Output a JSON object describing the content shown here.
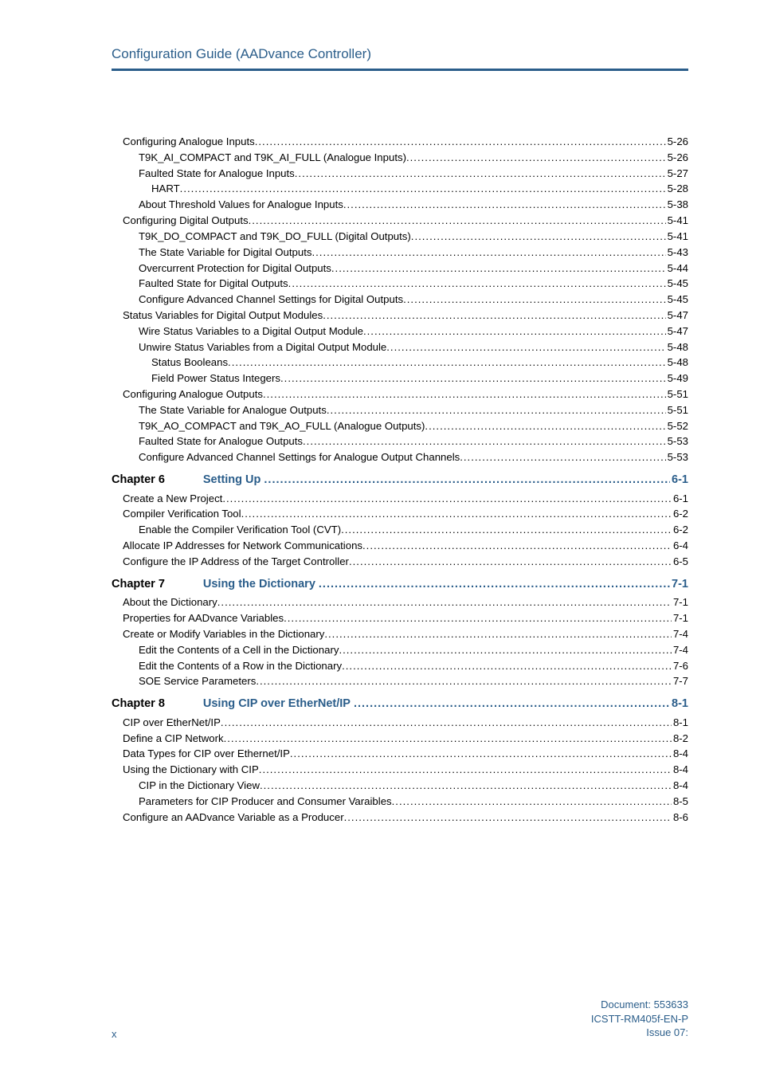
{
  "header": {
    "title": "Configuration Guide (AADvance Controller)"
  },
  "toc": [
    {
      "kind": "item",
      "level": 1,
      "label": "Configuring Analogue Inputs",
      "page": "5-26"
    },
    {
      "kind": "item",
      "level": 2,
      "label": "T9K_AI_COMPACT and T9K_AI_FULL (Analogue Inputs)",
      "page": "5-26"
    },
    {
      "kind": "item",
      "level": 2,
      "label": "Faulted State for Analogue Inputs",
      "page": "5-27"
    },
    {
      "kind": "item",
      "level": 3,
      "label": "HART",
      "page": "5-28"
    },
    {
      "kind": "item",
      "level": 2,
      "label": "About Threshold Values for Analogue Inputs",
      "page": "5-38"
    },
    {
      "kind": "item",
      "level": 1,
      "label": "Configuring Digital Outputs",
      "page": "5-41"
    },
    {
      "kind": "item",
      "level": 2,
      "label": "T9K_DO_COMPACT and T9K_DO_FULL (Digital Outputs)",
      "page": "5-41"
    },
    {
      "kind": "item",
      "level": 2,
      "label": "The State Variable for Digital Outputs",
      "page": "5-43"
    },
    {
      "kind": "item",
      "level": 2,
      "label": "Overcurrent Protection for Digital Outputs",
      "page": "5-44"
    },
    {
      "kind": "item",
      "level": 2,
      "label": "Faulted State for Digital Outputs",
      "page": "5-45"
    },
    {
      "kind": "item",
      "level": 2,
      "label": "Configure Advanced Channel Settings for Digital Outputs",
      "page": "5-45"
    },
    {
      "kind": "item",
      "level": 1,
      "label": "Status Variables for Digital Output Modules",
      "page": "5-47"
    },
    {
      "kind": "item",
      "level": 2,
      "label": "Wire Status Variables to a Digital Output Module",
      "page": "5-47"
    },
    {
      "kind": "item",
      "level": 2,
      "label": "Unwire Status Variables from a Digital Output Module",
      "page": "5-48"
    },
    {
      "kind": "item",
      "level": 3,
      "label": "Status Booleans",
      "page": "5-48"
    },
    {
      "kind": "item",
      "level": 3,
      "label": "Field Power Status Integers",
      "page": "5-49"
    },
    {
      "kind": "item",
      "level": 1,
      "label": "Configuring Analogue Outputs",
      "page": "5-51"
    },
    {
      "kind": "item",
      "level": 2,
      "label": "The State Variable for Analogue Outputs",
      "page": "5-51"
    },
    {
      "kind": "item",
      "level": 2,
      "label": "T9K_AO_COMPACT and T9K_AO_FULL (Analogue Outputs)",
      "page": "5-52"
    },
    {
      "kind": "item",
      "level": 2,
      "label": "Faulted State for Analogue Outputs",
      "page": "5-53"
    },
    {
      "kind": "item",
      "level": 2,
      "label": "Configure Advanced Channel Settings for Analogue Output Channels",
      "page": "5-53"
    },
    {
      "kind": "chapter",
      "chapter": "Chapter 6",
      "title": "Setting Up",
      "page": "6-1"
    },
    {
      "kind": "item",
      "level": 1,
      "label": "Create a New Project",
      "page": "6-1"
    },
    {
      "kind": "item",
      "level": 1,
      "label": "Compiler Verification Tool",
      "page": "6-2"
    },
    {
      "kind": "item",
      "level": 2,
      "label": "Enable the Compiler Verification Tool (CVT)",
      "page": "6-2"
    },
    {
      "kind": "item",
      "level": 1,
      "label": "Allocate IP Addresses for Network Communications",
      "page": "6-4"
    },
    {
      "kind": "item",
      "level": 1,
      "label": "Configure the IP Address of the Target Controller",
      "page": "6-5"
    },
    {
      "kind": "chapter",
      "chapter": "Chapter 7",
      "title": "Using the Dictionary",
      "page": "7-1"
    },
    {
      "kind": "item",
      "level": 1,
      "label": "About the Dictionary",
      "page": "7-1"
    },
    {
      "kind": "item",
      "level": 1,
      "label": "Properties for AADvance Variables",
      "page": "7-1"
    },
    {
      "kind": "item",
      "level": 1,
      "label": "Create or Modify Variables in the Dictionary",
      "page": "7-4"
    },
    {
      "kind": "item",
      "level": 2,
      "label": "Edit the Contents of a Cell in the Dictionary",
      "page": "7-4"
    },
    {
      "kind": "item",
      "level": 2,
      "label": "Edit the Contents of a Row in the Dictionary",
      "page": "7-6"
    },
    {
      "kind": "item",
      "level": 2,
      "label": "SOE Service Parameters",
      "page": "7-7"
    },
    {
      "kind": "chapter",
      "chapter": "Chapter 8",
      "title": "Using CIP over EtherNet/IP",
      "page": "8-1"
    },
    {
      "kind": "item",
      "level": 1,
      "label": "CIP over EtherNet/IP",
      "page": "8-1"
    },
    {
      "kind": "item",
      "level": 1,
      "label": "Define a CIP Network",
      "page": "8-2"
    },
    {
      "kind": "item",
      "level": 1,
      "label": "Data Types for CIP over Ethernet/IP",
      "page": "8-4"
    },
    {
      "kind": "item",
      "level": 1,
      "label": "Using the Dictionary with CIP",
      "page": "8-4"
    },
    {
      "kind": "item",
      "level": 2,
      "label": "CIP in the Dictionary View",
      "page": "8-4"
    },
    {
      "kind": "item",
      "level": 2,
      "label": "Parameters for CIP Producer and Consumer Varaibles",
      "page": "8-5"
    },
    {
      "kind": "item",
      "level": 1,
      "label": "Configure an AADvance Variable as a Producer",
      "page": "8-6"
    }
  ],
  "footer": {
    "page_number": "x",
    "doc_line1": "Document: 553633",
    "doc_line2": "ICSTT-RM405f-EN-P",
    "doc_line3": "Issue 07:"
  }
}
